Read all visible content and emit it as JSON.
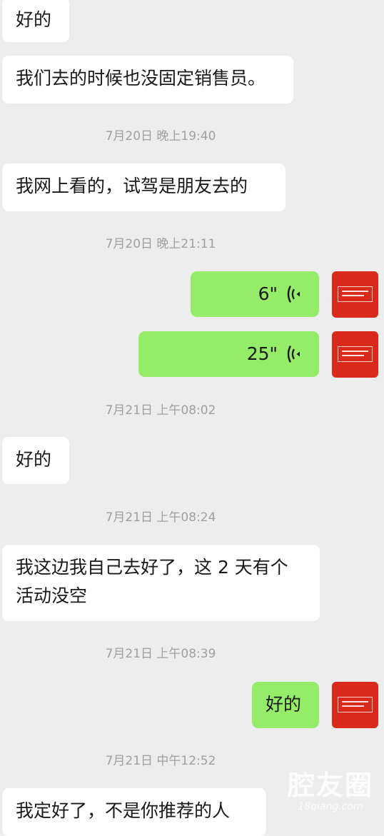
{
  "messages": {
    "m1": "好的",
    "m2": "我们去的时候也没固定销售员。",
    "m3": "我网上看的，试驾是朋友去的",
    "m4_duration": "6\"",
    "m5_duration": "25\"",
    "m6": "好的",
    "m7_line1": "我这边我自己去好了，这 2 天有个",
    "m7_line2": "活动没空",
    "m8": "好的",
    "m9": "我定好了，不是你推荐的人"
  },
  "timestamps": {
    "t1": "7月20日 晚上19:40",
    "t2": "7月20日 晚上21:11",
    "t3": "7月21日 上午08:02",
    "t4": "7月21日 上午08:24",
    "t5": "7月21日 上午08:39",
    "t6": "7月21日 中午12:52"
  },
  "watermark": {
    "main": "腔友圈",
    "sub": "18qiang.com"
  },
  "icons": {
    "voice": "voice-wave-icon",
    "avatar": "avatar-red-seal"
  },
  "colors": {
    "background": "#ededed",
    "received_bubble": "#ffffff",
    "sent_bubble": "#95ec69",
    "timestamp": "#9f9f9f",
    "avatar": "#d92a1c"
  }
}
